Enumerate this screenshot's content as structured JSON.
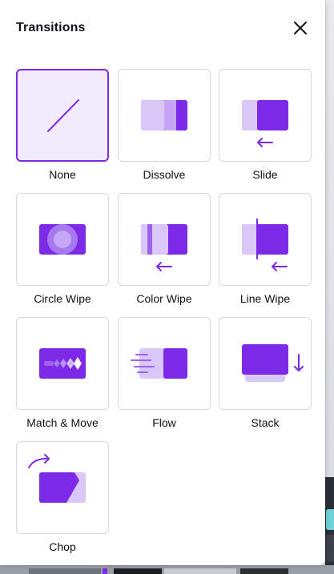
{
  "panel": {
    "title": "Transitions",
    "close_icon": "close-icon"
  },
  "colors": {
    "accent": "#7d2ae8",
    "accent_light": "#d9c8f7",
    "accent_mid": "#b58ef0",
    "selected_bg": "#f1ebfd"
  },
  "transitions": [
    {
      "label": "None",
      "icon": "none-transition-icon",
      "selected": true
    },
    {
      "label": "Dissolve",
      "icon": "dissolve-transition-icon",
      "selected": false
    },
    {
      "label": "Slide",
      "icon": "slide-transition-icon",
      "selected": false
    },
    {
      "label": "Circle Wipe",
      "icon": "circle-wipe-transition-icon",
      "selected": false
    },
    {
      "label": "Color Wipe",
      "icon": "color-wipe-transition-icon",
      "selected": false
    },
    {
      "label": "Line Wipe",
      "icon": "line-wipe-transition-icon",
      "selected": false
    },
    {
      "label": "Match & Move",
      "icon": "match-and-move-transition-icon",
      "selected": false
    },
    {
      "label": "Flow",
      "icon": "flow-transition-icon",
      "selected": false
    },
    {
      "label": "Stack",
      "icon": "stack-transition-icon",
      "selected": false
    },
    {
      "label": "Chop",
      "icon": "chop-transition-icon",
      "selected": false
    }
  ]
}
